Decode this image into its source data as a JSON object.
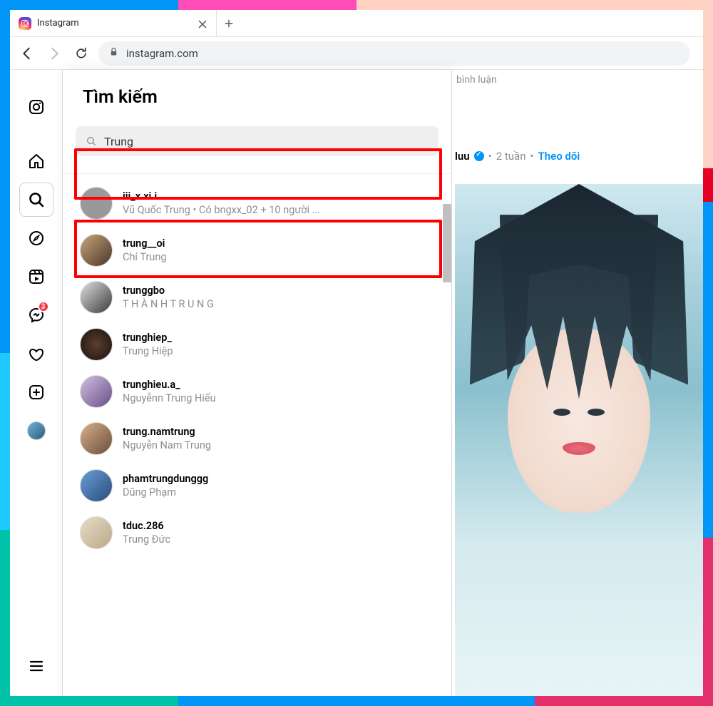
{
  "browser": {
    "tab_title": "Instagram",
    "url": "instagram.com"
  },
  "sidebar": {
    "badge_messages": "3"
  },
  "search": {
    "title": "Tìm kiếm",
    "query": "Trung",
    "results": [
      {
        "username": "iii_x.xi.i",
        "subtitle": "Vũ Quốc Trung • Có bngxx_02 + 10 người ...",
        "avatar_class": "av-grey"
      },
      {
        "username": "trung__oi",
        "subtitle": "Chí Trung",
        "avatar_class": "av-warm"
      },
      {
        "username": "trunggbo",
        "subtitle": "T H À N H T R U N G",
        "avatar_class": "av-bw"
      },
      {
        "username": "trunghiep_",
        "subtitle": "Trung Hiệp",
        "avatar_class": "av-dark"
      },
      {
        "username": "trunghieu.a_",
        "subtitle": "Nguyễnn Trung Hiếu",
        "avatar_class": "av-purple"
      },
      {
        "username": "trung.namtrung",
        "subtitle": "Nguyễn Nam Trung",
        "avatar_class": "av-indoor"
      },
      {
        "username": "phamtrungdunggg",
        "subtitle": "Dũng Phạm",
        "avatar_class": "av-blue"
      },
      {
        "username": "tduc.286",
        "subtitle": "Trung Đức",
        "avatar_class": "av-beige"
      }
    ]
  },
  "feed": {
    "comment_frag": "bình luận",
    "post": {
      "username_frag": "luu",
      "time": "2 tuần",
      "sep": "•",
      "follow": "Theo dõi"
    }
  }
}
